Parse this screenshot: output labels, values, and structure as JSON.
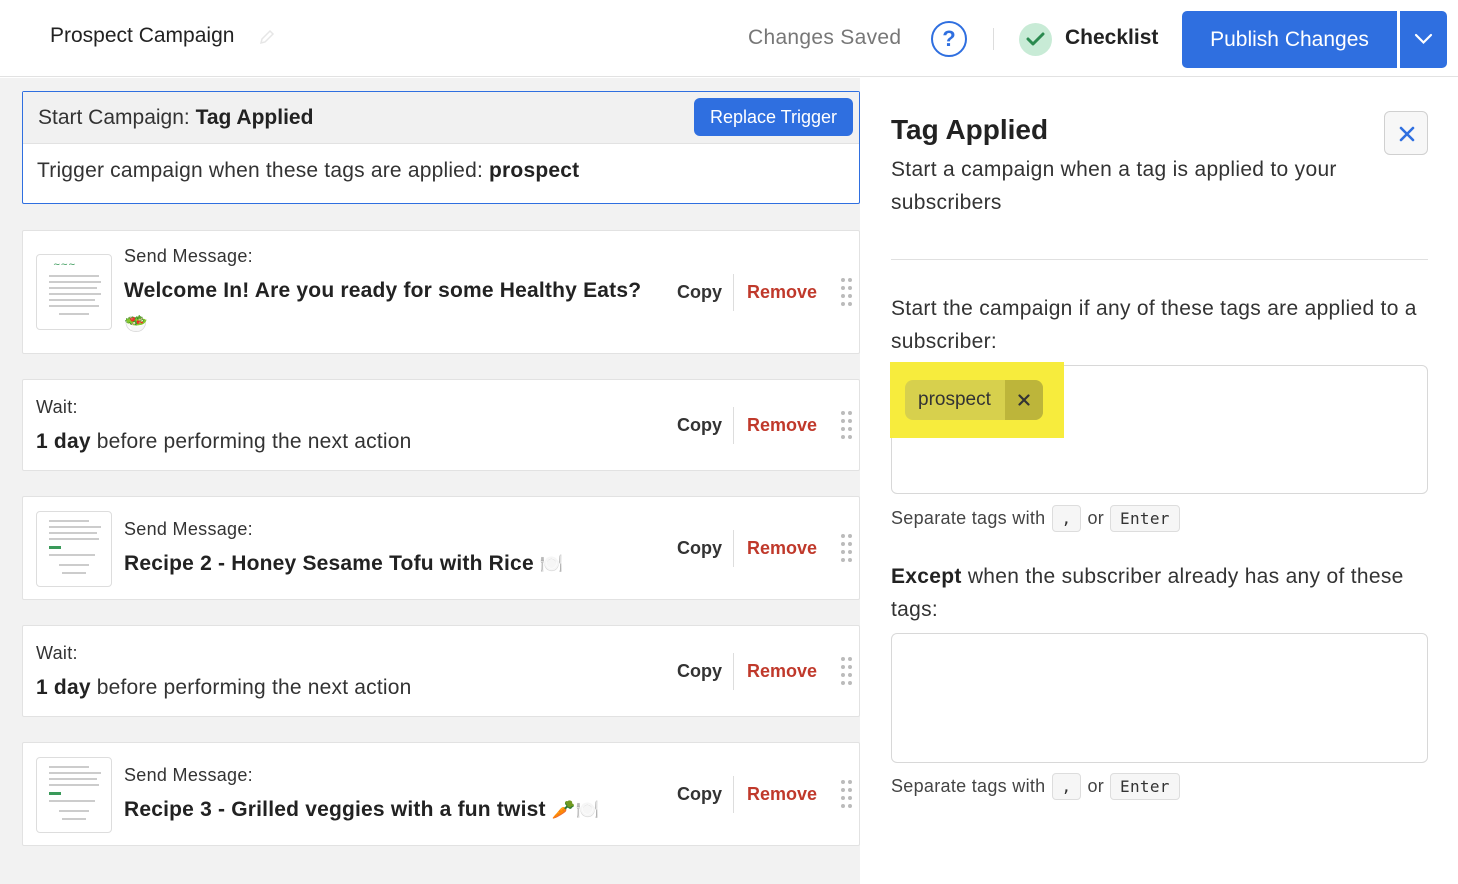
{
  "header": {
    "campaign_title": "Prospect Campaign",
    "save_status": "Changes Saved",
    "checklist_label": "Checklist",
    "publish_label": "Publish Changes"
  },
  "trigger": {
    "prefix": "Start Campaign:",
    "type": "Tag Applied",
    "replace_label": "Replace Trigger",
    "desc_prefix": "Trigger campaign when these tags are applied:",
    "tag": "prospect"
  },
  "actions": {
    "copy_label": "Copy",
    "remove_label": "Remove"
  },
  "steps": [
    {
      "label": "Send Message:",
      "title": "Welcome In! Are you ready for some Healthy Eats?",
      "emoji": "🥗"
    },
    {
      "label": "Wait:",
      "amount": "1 day",
      "rest": "before performing the next action"
    },
    {
      "label": "Send Message:",
      "title": "Recipe 2 - Honey Sesame Tofu with Rice",
      "emoji": "🍽️"
    },
    {
      "label": "Wait:",
      "amount": "1 day",
      "rest": "before performing the next action"
    },
    {
      "label": "Send Message:",
      "title": "Recipe 3 - Grilled veggies with a fun twist",
      "emoji": "🥕🍽️"
    }
  ],
  "panel": {
    "title": "Tag Applied",
    "description": "Start a campaign when a tag is applied to your subscribers",
    "include_label": "Start the campaign if any of these tags are applied to a subscriber:",
    "tags": [
      "prospect"
    ],
    "hint_prefix": "Separate tags with",
    "hint_comma": ",",
    "hint_or": "or",
    "hint_enter": "Enter",
    "except_bold": "Except",
    "except_rest": "when the subscriber already has any of these tags:"
  },
  "colors": {
    "accent": "#2f6fe0",
    "remove": "#c0392b",
    "highlight": "#f7ec3d"
  }
}
